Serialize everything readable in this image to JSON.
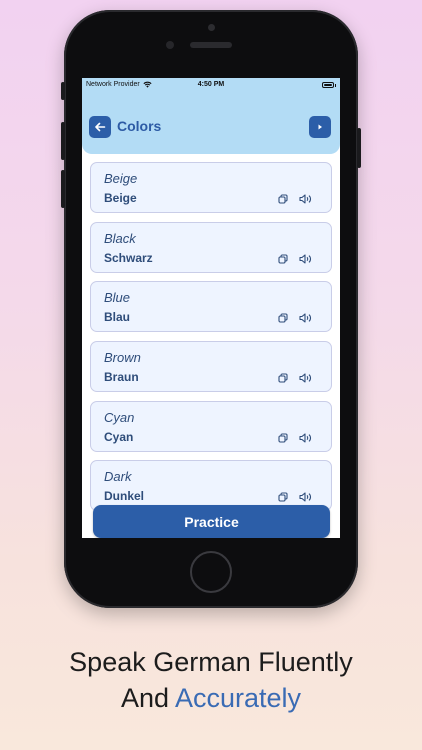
{
  "status_bar": {
    "carrier": "Network Provider",
    "time": "4:50 PM"
  },
  "header": {
    "title": "Colors",
    "back_icon": "arrow-left-icon",
    "next_icon": "play-triangle-icon"
  },
  "words": [
    {
      "english": "Beige",
      "german": "Beige"
    },
    {
      "english": "Black",
      "german": "Schwarz"
    },
    {
      "english": "Blue",
      "german": "Blau"
    },
    {
      "english": "Brown",
      "german": "Braun"
    },
    {
      "english": "Cyan",
      "german": "Cyan"
    },
    {
      "english": "Dark",
      "german": "Dunkel"
    }
  ],
  "practice_button": {
    "label": "Practice"
  },
  "tagline": {
    "line1": "Speak German Fluently",
    "line2_prefix": "And ",
    "line2_accent": "Accurately"
  },
  "colors": {
    "accent": "#2c5ea8",
    "header_bg": "#b3dcf5",
    "card_bg": "#eef4ff"
  }
}
